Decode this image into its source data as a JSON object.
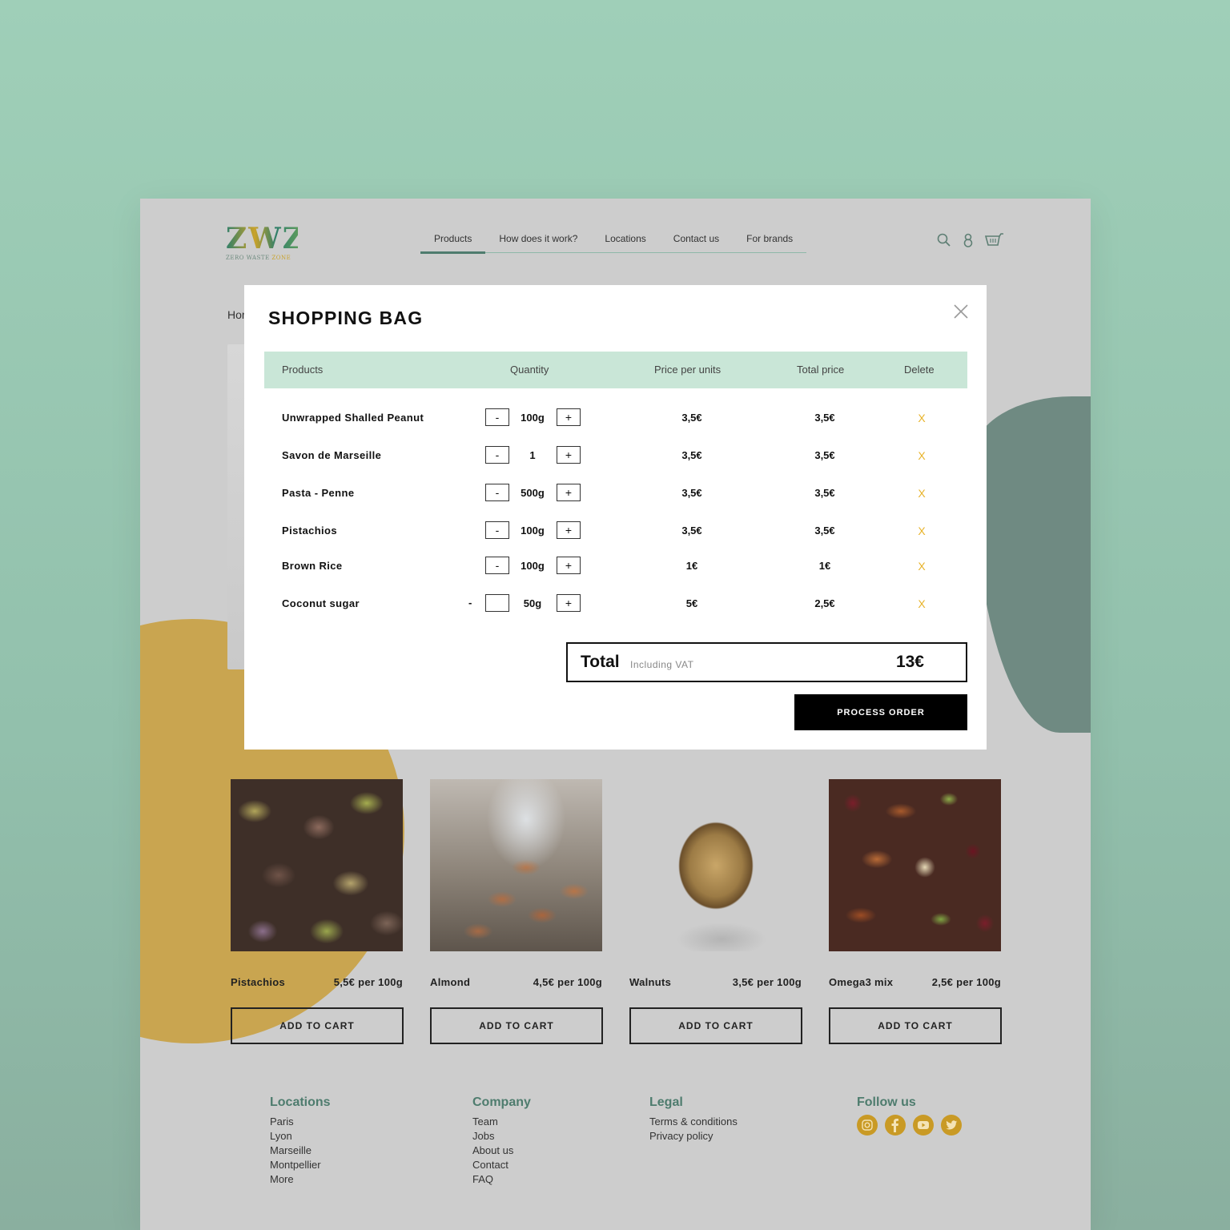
{
  "header": {
    "logo_mark": "ZWZ",
    "logo_sub_a": "ZERO WASTE ",
    "logo_sub_b": "ZONE",
    "nav": [
      {
        "label": "Products",
        "active": true
      },
      {
        "label": "How does it work?"
      },
      {
        "label": "Locations"
      },
      {
        "label": "Contact us"
      },
      {
        "label": "For brands"
      }
    ],
    "icons": [
      "search-icon",
      "user-icon",
      "cart-icon"
    ]
  },
  "breadcrumb": "Hor",
  "modal": {
    "title": "SHOPPING BAG",
    "columns": {
      "products": "Products",
      "quantity": "Quantity",
      "price_per_unit": "Price per units",
      "total_price": "Total price",
      "delete": "Delete"
    },
    "items": [
      {
        "name": "Unwrapped Shalled Peanut",
        "qty": "100g",
        "unit_price": "3,5€",
        "total": "3,5€",
        "delete": "X"
      },
      {
        "name": "Savon de Marseille",
        "qty": "1",
        "unit_price": "3,5€",
        "total": "3,5€",
        "delete": "X"
      },
      {
        "name": "Pasta - Penne",
        "qty": "500g",
        "unit_price": "3,5€",
        "total": "3,5€",
        "delete": "X"
      },
      {
        "name": "Pistachios",
        "qty": "100g",
        "unit_price": "3,5€",
        "total": "3,5€",
        "delete": "X"
      },
      {
        "name": "Brown Rice",
        "qty": "100g",
        "unit_price": "1€",
        "total": "1€",
        "delete": "X"
      },
      {
        "name": "Coconut sugar",
        "qty": "50g",
        "unit_price": "5€",
        "total": "2,5€",
        "delete": "X",
        "minus_outside": true
      }
    ],
    "minus_label": "-",
    "plus_label": "+",
    "total_label": "Total",
    "total_sub": "Including VAT",
    "total_value": "13€",
    "process_label": "PROCESS ORDER"
  },
  "products": [
    {
      "name": "Pistachios",
      "price": "5,5€ per 100g",
      "button": "ADD TO CART"
    },
    {
      "name": "Almond",
      "price": "4,5€ per 100g",
      "button": "ADD TO CART"
    },
    {
      "name": "Walnuts",
      "price": "3,5€ per 100g",
      "button": "ADD TO CART"
    },
    {
      "name": "Omega3 mix",
      "price": "2,5€ per 100g",
      "button": "ADD TO CART"
    }
  ],
  "footer": {
    "locations": {
      "title": "Locations",
      "links": [
        "Paris",
        "Lyon",
        "Marseille",
        "Montpellier",
        "More"
      ]
    },
    "company": {
      "title": "Company",
      "links": [
        "Team",
        "Jobs",
        "About us",
        "Contact",
        "FAQ"
      ]
    },
    "legal": {
      "title": "Legal",
      "links": [
        "Terms & conditions",
        "Privacy policy"
      ]
    },
    "follow": {
      "title": "Follow us",
      "icons": [
        "instagram-icon",
        "facebook-icon",
        "youtube-icon",
        "twitter-icon"
      ]
    }
  },
  "colors": {
    "accent_green": "#4e7c6e",
    "table_header": "#c9e6d7",
    "delete_x": "#e8b32a",
    "social_gold": "#c99a25"
  }
}
